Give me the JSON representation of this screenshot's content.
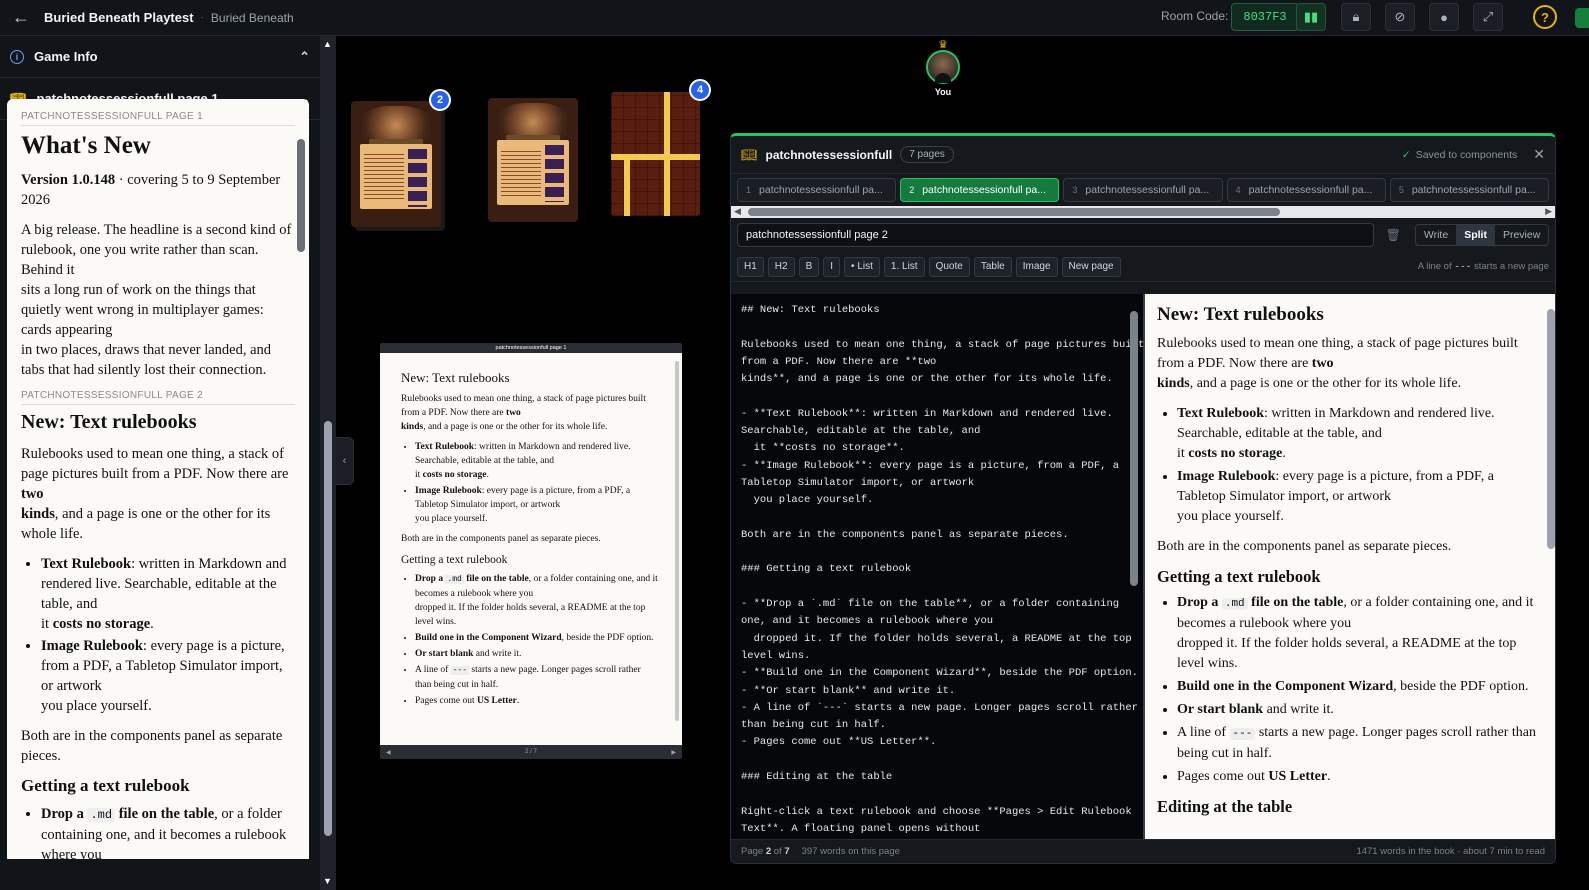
{
  "topbar": {
    "title": "Buried Beneath Playtest",
    "separator": "·",
    "subtitle": "Buried Beneath",
    "room_label": "Room Code:",
    "room_code": "8037F3",
    "help": "?",
    "icons": [
      "chart-icon",
      "lock-icon",
      "eye-off-icon",
      "mic-icon",
      "fullscreen-icon",
      "help-icon"
    ]
  },
  "sidebar": {
    "game_info": "Game Info",
    "book_title": "patchnotessessionfull page 1",
    "doc": {
      "sec1": "PATCHNOTESSESSIONFULL PAGE 1",
      "h1": "What's New",
      "version_bold": "Version 1.0.148",
      "version_rest": " · covering 5 to 9 September 2026",
      "intro1": "A big release. The headline is a second kind of rulebook, one you write rather than scan. Behind it",
      "intro2": "sits a long run of work on the things that quietly went wrong in multiplayer games: cards appearing",
      "intro3": "in two places, draws that never landed, and tabs that had silently lost their connection.",
      "sec2": "PATCHNOTESSESSIONFULL PAGE 2",
      "h2": "New: Text rulebooks",
      "p1a": "Rulebooks used to mean one thing, a stack of page pictures built from a PDF. Now there are ",
      "p1b": "two",
      "p1c": "kinds",
      "p1d": ", and a page is one or the other for its whole life.",
      "li1a": "Text Rulebook",
      "li1b": ": written in Markdown and rendered live. Searchable, editable at the table, and",
      "li1c": "it ",
      "li1d": "costs no storage",
      "li1e": ".",
      "li2a": "Image Rulebook",
      "li2b": ": every page is a picture, from a PDF, a Tabletop Simulator import, or artwork",
      "li2c": "you place yourself.",
      "p2": "Both are in the components panel as separate pieces.",
      "h3": "Getting a text rulebook",
      "li3a": "Drop a ",
      "li3code": ".md",
      "li3b": " file on the table",
      "li3c": ", or a folder containing one, and it becomes a rulebook where you"
    }
  },
  "mini": {
    "header": "patchnotessessionfull page 1",
    "pager": "2 / 7"
  },
  "avatar": {
    "crown": "♛",
    "label": "You"
  },
  "cards": {
    "badge1": "2",
    "badge2": "4"
  },
  "panel": {
    "title": "patchnotessessionfull",
    "pages_badge": "7 pages",
    "saved": "Saved to components",
    "tabs": [
      {
        "n": "1",
        "label": "patchnotessessionfull pa..."
      },
      {
        "n": "2",
        "label": "patchnotessessionfull pa..."
      },
      {
        "n": "3",
        "label": "patchnotessessionfull pa..."
      },
      {
        "n": "4",
        "label": "patchnotessessionfull pa..."
      },
      {
        "n": "5",
        "label": "patchnotessessionfull pa..."
      }
    ],
    "page_name": "patchnotessessionfull page 2",
    "modes": {
      "write": "Write",
      "split": "Split",
      "preview": "Preview"
    },
    "toolbar": {
      "h1": "H1",
      "h2": "H2",
      "b": "B",
      "i": "I",
      "list": "• List",
      "olist": "1. List",
      "quote": "Quote",
      "table": "Table",
      "image": "Image",
      "newpage": "New page"
    },
    "hint_a": "A line of ",
    "hint_code": "---",
    "hint_b": " starts a new page",
    "editor_text": "## New: Text rulebooks\n\nRulebooks used to mean one thing, a stack of page pictures built\nfrom a PDF. Now there are **two\nkinds**, and a page is one or the other for its whole life.\n\n- **Text Rulebook**: written in Markdown and rendered live.\nSearchable, editable at the table, and\n  it **costs no storage**.\n- **Image Rulebook**: every page is a picture, from a PDF, a\nTabletop Simulator import, or artwork\n  you place yourself.\n\nBoth are in the components panel as separate pieces.\n\n### Getting a text rulebook\n\n- **Drop a `.md` file on the table**, or a folder containing\none, and it becomes a rulebook where you\n  dropped it. If the folder holds several, a README at the top\nlevel wins.\n- **Build one in the Component Wizard**, beside the PDF option.\n- **Or start blank** and write it.\n- A line of `---` starts a new page. Longer pages scroll rather\nthan being cut in half.\n- Pages come out **US Letter**.\n\n### Editing at the table\n\nRight-click a text rulebook and choose **Pages > Edit Rulebook\nText**. A floating panel opens without",
    "preview": {
      "h2": "New: Text rulebooks",
      "p1a": "Rulebooks used to mean one thing, a stack of page pictures built from a PDF. Now there are ",
      "p1b": "two",
      "p1c": "kinds",
      "p1d": ", and a page is one or the other for its whole life.",
      "li1a": "Text Rulebook",
      "li1b": ": written in Markdown and rendered live. Searchable, editable at the table, and",
      "li1c": "it ",
      "li1d": "costs no storage",
      "li1e": ".",
      "li2a": "Image Rulebook",
      "li2b": ": every page is a picture, from a PDF, a Tabletop Simulator import, or artwork",
      "li2c": "you place yourself.",
      "p2": "Both are in the components panel as separate pieces.",
      "h3": "Getting a text rulebook",
      "g1a": "Drop a ",
      "g1code": ".md",
      "g1b": " file on the table",
      "g1c": ", or a folder containing one, and it becomes a rulebook where you",
      "g1d": "dropped it. If the folder holds several, a README at the top level wins.",
      "g2a": "Build one in the Component Wizard",
      "g2b": ", beside the PDF option.",
      "g3a": "Or start blank",
      "g3b": " and write it.",
      "g4a": "A line of ",
      "g4code": "---",
      "g4b": " starts a new page. Longer pages scroll rather than being cut in half.",
      "g5a": "Pages come out ",
      "g5b": "US Letter",
      "g5c": ".",
      "h3b": "Editing at the table"
    },
    "footer": {
      "page_pre": "Page ",
      "page_num": "2",
      "page_mid": " of ",
      "page_total": "7",
      "words": "397 words on this page",
      "book": "1471 words in the book · about 7 min to read"
    }
  }
}
